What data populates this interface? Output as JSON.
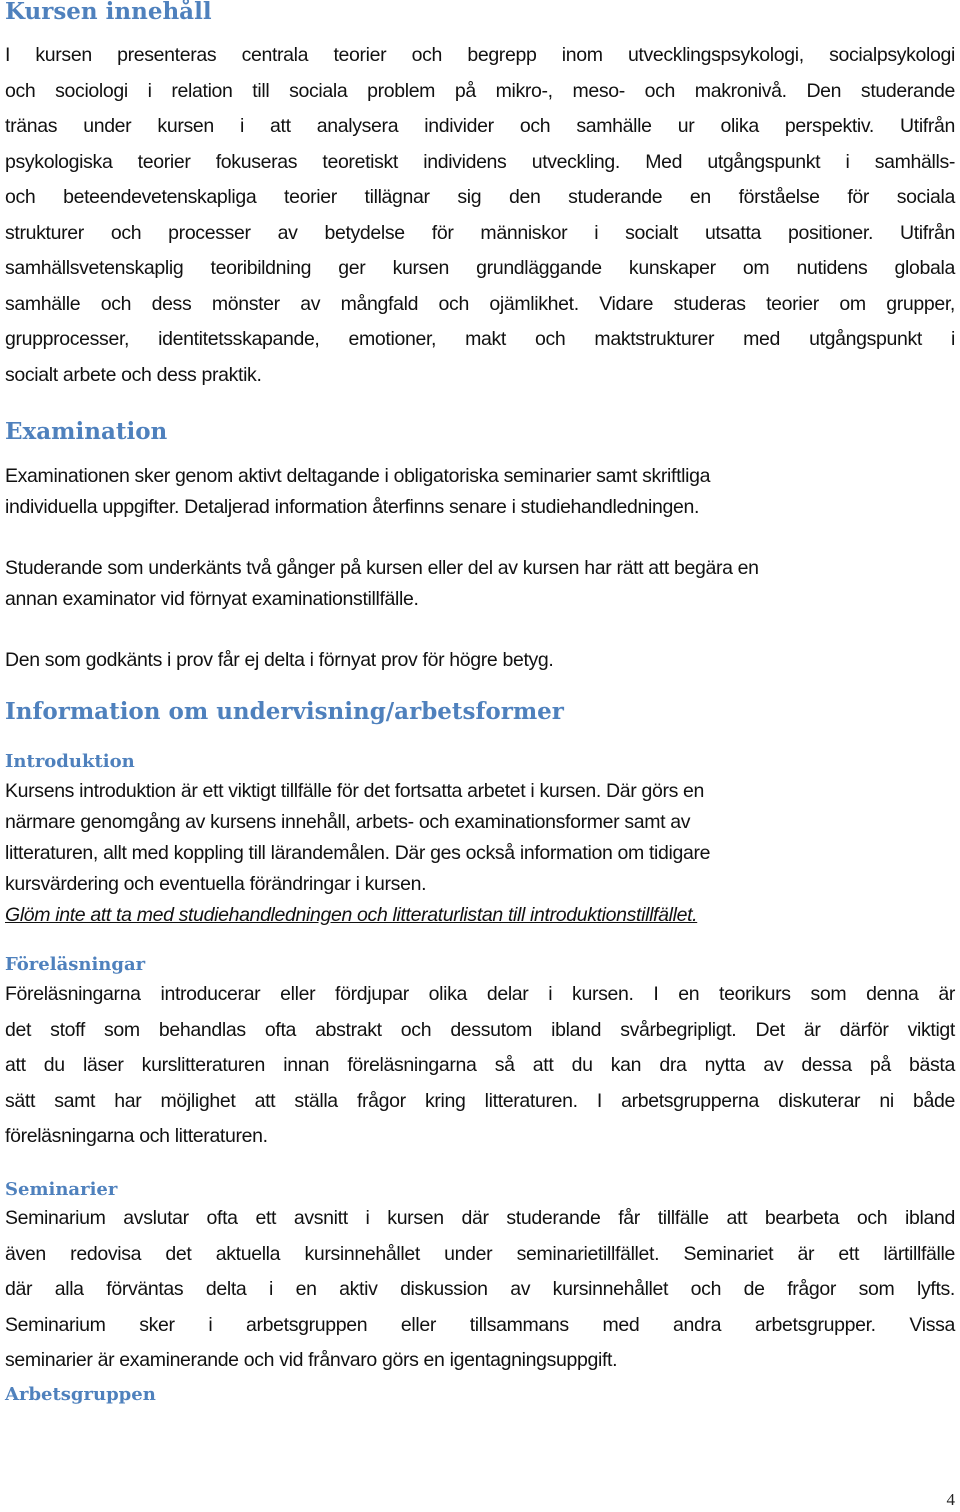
{
  "document": {
    "sections": {
      "kursen_innehall": {
        "heading": "Kursen innehåll",
        "lines": [
          "I kursen presenteras centrala teorier och begrepp inom utvecklingspsykologi, socialpsykologi",
          "och sociologi i relation till sociala problem på mikro-, meso- och makronivå. Den studerande",
          "tränas under kursen i att analysera individer och samhälle ur olika perspektiv. Utifrån",
          "psykologiska teorier fokuseras teoretiskt individens utveckling. Med utgångspunkt i samhälls-",
          "och beteendevetenskapliga teorier tillägnar sig den studerande en förståelse för sociala",
          "strukturer och processer av betydelse för människor i socialt utsatta positioner. Utifrån",
          "samhällsvetenskaplig teoribildning ger kursen grundläggande kunskaper om nutidens globala",
          "samhälle och dess mönster av mångfald och ojämlikhet. Vidare studeras teorier om grupper,",
          "grupprocesser, identitetsskapande, emotioner, makt och maktstrukturer med utgångspunkt i",
          "socialt arbete och dess praktik."
        ]
      },
      "examination": {
        "heading": "Examination",
        "paragraphs": [
          [
            "Examinationen sker genom aktivt deltagande i obligatoriska seminarier samt skriftliga",
            "individuella uppgifter. Detaljerad information återfinns senare i studiehandledningen."
          ],
          [
            "Studerande som underkänts två gånger på kursen eller del av kursen har rätt att begära en",
            "annan examinator vid förnyat examinationstillfälle."
          ],
          [
            "Den som godkänts i prov får ej delta i förnyat prov för högre betyg."
          ]
        ]
      },
      "information": {
        "heading": "Information om undervisning/arbetsformer",
        "introduktion": {
          "heading": "Introduktion",
          "lines": [
            "Kursens introduktion är ett viktigt tillfälle för det fortsatta arbetet i kursen. Där görs en",
            "närmare genomgång av kursens innehåll, arbets- och examinationsformer samt av",
            "litteraturen, allt med koppling till lärandemålen. Där ges också information om tidigare",
            "kursvärdering och eventuella förändringar i kursen."
          ],
          "note": "Glöm inte att ta med studiehandledningen och litteraturlistan till introduktionstillfället."
        },
        "forelasningar": {
          "heading": "Föreläsningar",
          "lines": [
            "Föreläsningarna introducerar eller fördjupar olika delar i kursen. I en teorikurs som denna är",
            "det stoff som behandlas ofta abstrakt och dessutom ibland svårbegripligt. Det är därför viktigt",
            "att du läser kurslitteraturen innan föreläsningarna så att du kan dra nytta av dessa på bästa",
            "sätt samt har möjlighet att ställa frågor kring litteraturen. I arbetsgrupperna diskuterar ni både",
            "föreläsningarna och litteraturen."
          ]
        },
        "seminarier": {
          "heading": "Seminarier",
          "lines": [
            "Seminarium avslutar ofta ett avsnitt i kursen där studerande får tillfälle att bearbeta och ibland",
            "även redovisa det aktuella kursinnehållet under seminarietillfället. Seminariet är ett lärtillfälle",
            "där alla förväntas delta i en aktiv diskussion av kursinnehållet och de frågor som lyfts.",
            "Seminarium sker i arbetsgruppen eller tillsammans med andra arbetsgrupper. Vissa",
            "seminarier är examinerande och vid frånvaro görs en igentagningsuppgift."
          ]
        },
        "arbetsgruppen": {
          "heading": "Arbetsgruppen"
        }
      }
    },
    "page_number": "4",
    "colors": {
      "heading": "#4f81bd",
      "body_text": "#111111"
    }
  }
}
